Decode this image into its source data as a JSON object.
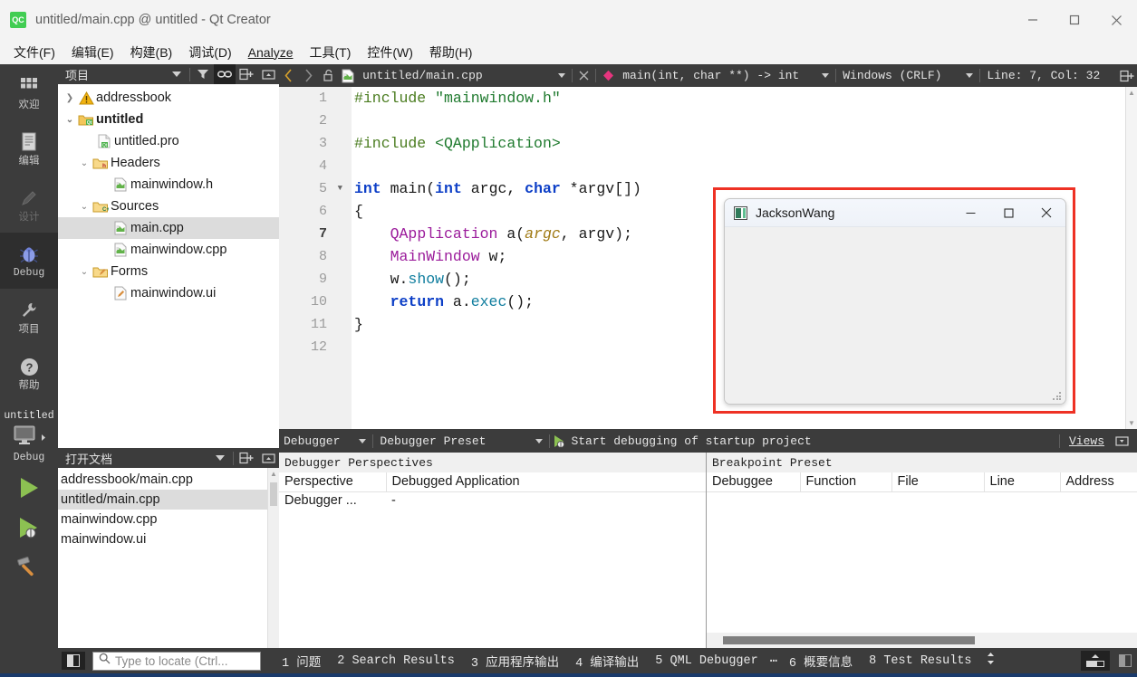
{
  "window": {
    "title": "untitled/main.cpp @ untitled - Qt Creator",
    "logo_text": "QC",
    "logo_icon": "qt-creator-logo-icon",
    "minimize_icon": "minimize-icon",
    "maximize_icon": "maximize-icon",
    "close_icon": "close-icon"
  },
  "menubar": {
    "items": [
      {
        "label": "文件(F)",
        "mnemonic": "F"
      },
      {
        "label": "编辑(E)",
        "mnemonic": "E"
      },
      {
        "label": "构建(B)",
        "mnemonic": "B"
      },
      {
        "label": "调试(D)",
        "mnemonic": "D"
      },
      {
        "label": "Analyze",
        "mnemonic": "A"
      },
      {
        "label": "工具(T)",
        "mnemonic": "T"
      },
      {
        "label": "控件(W)",
        "mnemonic": "W"
      },
      {
        "label": "帮助(H)",
        "mnemonic": "H"
      }
    ]
  },
  "modebar": {
    "modes": [
      {
        "label": "欢迎",
        "icon": "grid-icon",
        "state": "normal"
      },
      {
        "label": "编辑",
        "icon": "document-lines-icon",
        "state": "normal"
      },
      {
        "label": "设计",
        "icon": "pencil-icon",
        "state": "disabled"
      },
      {
        "label": "Debug",
        "icon": "bug-icon",
        "state": "active"
      },
      {
        "label": "项目",
        "icon": "wrench-icon",
        "state": "normal"
      },
      {
        "label": "帮助",
        "icon": "question-mark-icon",
        "state": "normal"
      }
    ],
    "kit_selector": {
      "project": "untitled",
      "build_config": "Debug",
      "icon": "monitor-icon",
      "expand_icon": "chevron-right-icon"
    },
    "actions": [
      {
        "name": "run-button",
        "icon": "green-play-icon"
      },
      {
        "name": "start-debugging-button",
        "icon": "play-with-bug-icon"
      },
      {
        "name": "build-button",
        "icon": "hammer-icon"
      }
    ]
  },
  "project_panel": {
    "title": "项目",
    "header_buttons": [
      {
        "name": "filter-tree-button",
        "icon": "filter-icon",
        "active": false
      },
      {
        "name": "synchronize-selection-button",
        "icon": "link-icon",
        "active": true
      },
      {
        "name": "split-button",
        "icon": "split-add-icon",
        "active": false
      },
      {
        "name": "close-sidebar-button",
        "icon": "minimize-panel-icon",
        "active": false
      }
    ],
    "tree": [
      {
        "label": "addressbook",
        "indent": 0,
        "expander": "collapsed",
        "icon": "warning-icon",
        "bold": false,
        "selected": false
      },
      {
        "label": "untitled",
        "indent": 0,
        "expander": "expanded",
        "icon": "qt-project-folder-icon",
        "bold": true,
        "selected": false
      },
      {
        "label": "untitled.pro",
        "indent": 1,
        "expander": "none",
        "icon": "qt-pro-file-icon",
        "bold": false,
        "selected": false
      },
      {
        "label": "Headers",
        "indent": 1,
        "expander": "expanded",
        "icon": "headers-folder-icon",
        "bold": false,
        "selected": false
      },
      {
        "label": "mainwindow.h",
        "indent": 2,
        "expander": "none",
        "icon": "cpp-header-file-icon",
        "bold": false,
        "selected": false
      },
      {
        "label": "Sources",
        "indent": 1,
        "expander": "expanded",
        "icon": "sources-folder-icon",
        "bold": false,
        "selected": false
      },
      {
        "label": "main.cpp",
        "indent": 2,
        "expander": "none",
        "icon": "cpp-source-file-icon",
        "bold": false,
        "selected": true
      },
      {
        "label": "mainwindow.cpp",
        "indent": 2,
        "expander": "none",
        "icon": "cpp-source-file-icon",
        "bold": false,
        "selected": false
      },
      {
        "label": "Forms",
        "indent": 1,
        "expander": "expanded",
        "icon": "forms-folder-icon",
        "bold": false,
        "selected": false
      },
      {
        "label": "mainwindow.ui",
        "indent": 2,
        "expander": "none",
        "icon": "ui-form-file-icon",
        "bold": false,
        "selected": false
      }
    ]
  },
  "open_documents_panel": {
    "title": "打开文档",
    "header_buttons": [
      {
        "name": "split-button",
        "icon": "split-add-icon"
      },
      {
        "name": "close-sidebar-button",
        "icon": "minimize-panel-icon"
      }
    ],
    "items": [
      {
        "label": "addressbook/main.cpp",
        "selected": false
      },
      {
        "label": "untitled/main.cpp",
        "selected": true
      },
      {
        "label": "mainwindow.cpp",
        "selected": false
      },
      {
        "label": "mainwindow.ui",
        "selected": false
      }
    ]
  },
  "editor_toolbar": {
    "back_icon": "chevron-left-icon",
    "forward_icon": "chevron-right-icon",
    "lock_icon": "unlocked-icon",
    "file_icon": "cpp-source-file-icon",
    "file_path": "untitled/main.cpp",
    "file_dropdown_icon": "chevron-down-icon",
    "close_icon": "close-icon",
    "symbol_marker_icon": "pink-diamond-icon",
    "symbol": "main(int, char **) -> int",
    "symbol_dropdown_icon": "chevron-down-icon",
    "line_ending": "Windows (CRLF)",
    "line_ending_dropdown_icon": "chevron-down-icon",
    "cursor_position": "Line: 7, Col: 32",
    "split_icon": "split-add-icon"
  },
  "editor": {
    "current_line": 7,
    "total_lines": 12,
    "fold_marker_line": 5,
    "lines": [
      {
        "n": 1,
        "tokens": [
          {
            "t": "#include ",
            "c": "pre"
          },
          {
            "t": "\"mainwindow.h\"",
            "c": "str"
          }
        ]
      },
      {
        "n": 2,
        "tokens": []
      },
      {
        "n": 3,
        "tokens": [
          {
            "t": "#include ",
            "c": "pre"
          },
          {
            "t": "<QApplication>",
            "c": "str"
          }
        ]
      },
      {
        "n": 4,
        "tokens": []
      },
      {
        "n": 5,
        "tokens": [
          {
            "t": "int",
            "c": "kw"
          },
          {
            "t": " main(",
            "c": "txt"
          },
          {
            "t": "int",
            "c": "kw"
          },
          {
            "t": " argc, ",
            "c": "txt"
          },
          {
            "t": "char",
            "c": "kw"
          },
          {
            "t": " *argv[])",
            "c": "txt"
          }
        ]
      },
      {
        "n": 6,
        "tokens": [
          {
            "t": "{",
            "c": "txt"
          }
        ]
      },
      {
        "n": 7,
        "tokens": [
          {
            "t": "    ",
            "c": "txt"
          },
          {
            "t": "QApplication",
            "c": "typ"
          },
          {
            "t": " a(",
            "c": "txt"
          },
          {
            "t": "argc",
            "c": "par"
          },
          {
            "t": ", argv);",
            "c": "txt"
          }
        ]
      },
      {
        "n": 8,
        "tokens": [
          {
            "t": "    ",
            "c": "txt"
          },
          {
            "t": "MainWindow",
            "c": "typ"
          },
          {
            "t": " w;",
            "c": "txt"
          }
        ]
      },
      {
        "n": 9,
        "tokens": [
          {
            "t": "    w.",
            "c": "txt"
          },
          {
            "t": "show",
            "c": "fn"
          },
          {
            "t": "();",
            "c": "txt"
          }
        ]
      },
      {
        "n": 10,
        "tokens": [
          {
            "t": "    ",
            "c": "txt"
          },
          {
            "t": "return",
            "c": "kw2"
          },
          {
            "t": " a.",
            "c": "txt"
          },
          {
            "t": "exec",
            "c": "fn"
          },
          {
            "t": "();",
            "c": "txt"
          }
        ]
      },
      {
        "n": 11,
        "tokens": [
          {
            "t": "}",
            "c": "txt"
          }
        ]
      },
      {
        "n": 12,
        "tokens": []
      }
    ]
  },
  "running_app_window": {
    "title": "JacksonWang",
    "icon": "app-icon",
    "minimize_icon": "minimize-icon",
    "maximize_icon": "maximize-icon",
    "close_icon": "close-icon",
    "annotation_color": "#ee3124",
    "resize_grip_icon": "resize-grip-icon"
  },
  "debugger_toolbar": {
    "perspective": "Debugger",
    "perspective_dropdown_icon": "chevron-down-icon",
    "preset": "Debugger Preset",
    "preset_dropdown_icon": "chevron-down-icon",
    "start_label": "Start debugging of startup project",
    "start_icon": "play-with-bug-icon",
    "views_label": "Views",
    "views_icon": "panel-icon"
  },
  "perspectives_dock": {
    "title": "Debugger Perspectives",
    "columns": [
      "Perspective",
      "Debugged Application"
    ],
    "rows": [
      [
        "Debugger ...",
        "-"
      ]
    ]
  },
  "breakpoints_dock": {
    "title": "Breakpoint Preset",
    "columns": [
      "Debuggee",
      "Function",
      "File",
      "Line",
      "Address"
    ],
    "rows": []
  },
  "statusbar": {
    "sidebar_toggle_icon": "sidebar-toggle-icon",
    "locator": {
      "icon": "search-icon",
      "value": "",
      "placeholder": "Type to locate (Ctrl..."
    },
    "output_panes": [
      {
        "key": "1",
        "label": "问题"
      },
      {
        "key": "2",
        "label": "Search Results"
      },
      {
        "key": "3",
        "label": "应用程序输出"
      },
      {
        "key": "4",
        "label": "编译输出"
      },
      {
        "key": "5",
        "label": "QML Debugger"
      },
      {
        "key": "",
        "label": "⋯"
      },
      {
        "key": "6",
        "label": "概要信息"
      },
      {
        "key": "8",
        "label": "Test Results"
      }
    ],
    "expand_icon": "up-down-arrows-icon",
    "progress_details_icon": "progress-bar-icon",
    "right_sidebar_toggle_icon": "sidebar-toggle-icon"
  },
  "colors": {
    "chrome_dark": "#3c3c3c",
    "chrome_darker": "#2e2e2e",
    "titlebar": "#f3f3f3",
    "selection": "#dcdcdc",
    "annotation_red": "#ee3124",
    "qt_green": "#41cd52",
    "taskbar_blue": "#1a3a6b"
  }
}
